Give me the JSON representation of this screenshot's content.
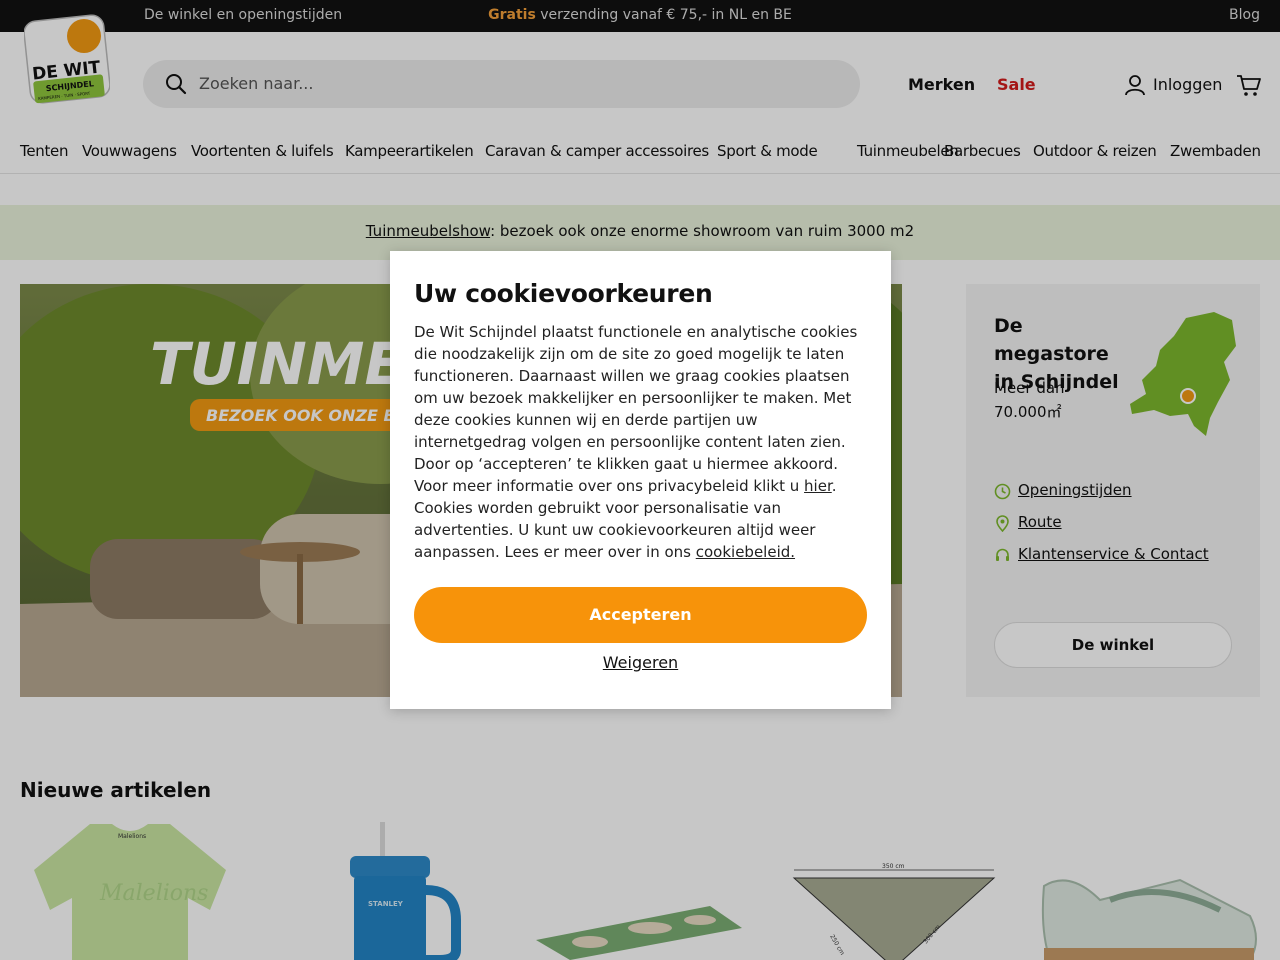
{
  "topbar": {
    "left_link": "De winkel en openingstijden",
    "promo_highlight": "Gratis",
    "promo_text": " verzending vanaf € 75,- in NL en BE",
    "right_link": "Blog"
  },
  "header": {
    "logo_text": "DE WIT",
    "logo_sub": "SCHIJNDEL",
    "logo_tagline": "KAMPEREN · TUIN · SPORT",
    "search_placeholder": "Zoeken naar...",
    "brands_label": "Merken",
    "sale_label": "Sale",
    "login_label": "Inloggen"
  },
  "categories": [
    "Tenten",
    "Vouwwagens",
    "Voortenten & luifels",
    "Kampeerartikelen",
    "Caravan & camper accessoires",
    "Sport & mode",
    "Tuinmeubelen",
    "Barbecues",
    "Outdoor & reizen",
    "Zwembaden"
  ],
  "promo": {
    "link": "Tuinmeubelshow",
    "text": ": bezoek ook onze enorme showroom van ruim 3000 m2"
  },
  "hero": {
    "headline": "TUINMEUBELSHOW",
    "subline": "BEZOEK OOK ONZE ENORME SHOWROOM"
  },
  "store": {
    "title": "De megastore in Schijndel",
    "subtitle_line1": "Meer dan",
    "subtitle_line2": "70.000㎡",
    "links": [
      "Openingstijden",
      "Route",
      "Klantenservice & Contact"
    ],
    "button": "De winkel"
  },
  "new_articles": {
    "title": "Nieuwe artikelen",
    "sail_labels": [
      "350 cm",
      "250 cm",
      "300 cm"
    ],
    "shirt_print": "Malelions",
    "bottle_brand": "STANLEY"
  },
  "cookie": {
    "title": "Uw cookievoorkeuren",
    "body_1": "De Wit Schijndel plaatst functionele en analytische cookies die noodzakelijk zijn om de site zo goed mogelijk te laten functioneren. Daarnaast willen we graag cookies plaatsen om uw bezoek makkelijker en persoonlijker te maken. Met deze cookies kunnen wij en derde partijen uw internetgedrag volgen en persoonlijke content laten zien. Door op ‘accepteren’ te klikken gaat u hiermee akkoord. Voor meer informatie over ons privacybeleid klikt u ",
    "link_here": "hier",
    "body_2": ". Cookies worden gebruikt voor personalisatie van advertenties. U kunt uw cookievoorkeuren altijd weer aanpassen. Lees er meer over in ons ",
    "link_policy": "cookiebeleid.",
    "accept": "Accepteren",
    "decline": "Weigeren"
  },
  "colors": {
    "topbar_bg": "#111111",
    "accent_orange": "#f7930a",
    "sale_red": "#d31b1b",
    "promo_bg": "#e9f3dc",
    "store_green": "#7db82e"
  }
}
